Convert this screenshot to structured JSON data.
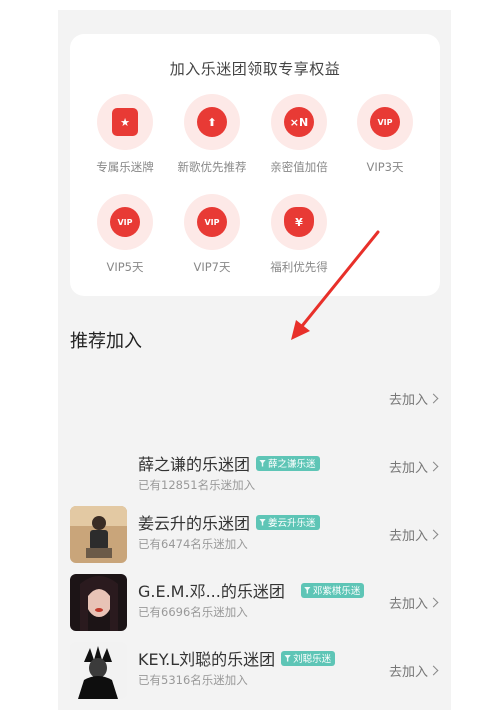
{
  "benefits": {
    "title": "加入乐迷团领取专享权益",
    "items": [
      {
        "label": "专属乐迷牌",
        "icon": "badge-icon",
        "glyph": "★"
      },
      {
        "label": "新歌优先推荐",
        "icon": "upload-icon",
        "glyph": "⬆"
      },
      {
        "label": "亲密值加倍",
        "icon": "multiply-icon",
        "glyph": "×N"
      },
      {
        "label": "VIP3天",
        "icon": "vip-icon",
        "glyph": "VIP"
      },
      {
        "label": "VIP5天",
        "icon": "vip-icon",
        "glyph": "VIP"
      },
      {
        "label": "VIP7天",
        "icon": "vip-icon",
        "glyph": "VIP"
      },
      {
        "label": "福利优先得",
        "icon": "money-bag-icon",
        "glyph": "¥"
      }
    ]
  },
  "recommend": {
    "title": "推荐加入",
    "join_label": "去加入",
    "rows": [
      {
        "name": "",
        "tag": "",
        "count": ""
      },
      {
        "name": "薛之谦的乐迷团",
        "tag": "薛之谦乐迷",
        "count": "已有12851名乐迷加入"
      },
      {
        "name": "姜云升的乐迷团",
        "tag": "姜云升乐迷",
        "count": "已有6474名乐迷加入"
      },
      {
        "name": "G.E.M.邓...的乐迷团",
        "tag": "邓紫棋乐迷",
        "count": "已有6696名乐迷加入"
      },
      {
        "name": "KEY.L刘聪的乐迷团",
        "tag": "刘聪乐迷",
        "count": "已有5316名乐迷加入"
      }
    ]
  },
  "colors": {
    "accent": "#e83a35",
    "tag": "#5ec5b6",
    "annotation_arrow": "#e8302a"
  }
}
